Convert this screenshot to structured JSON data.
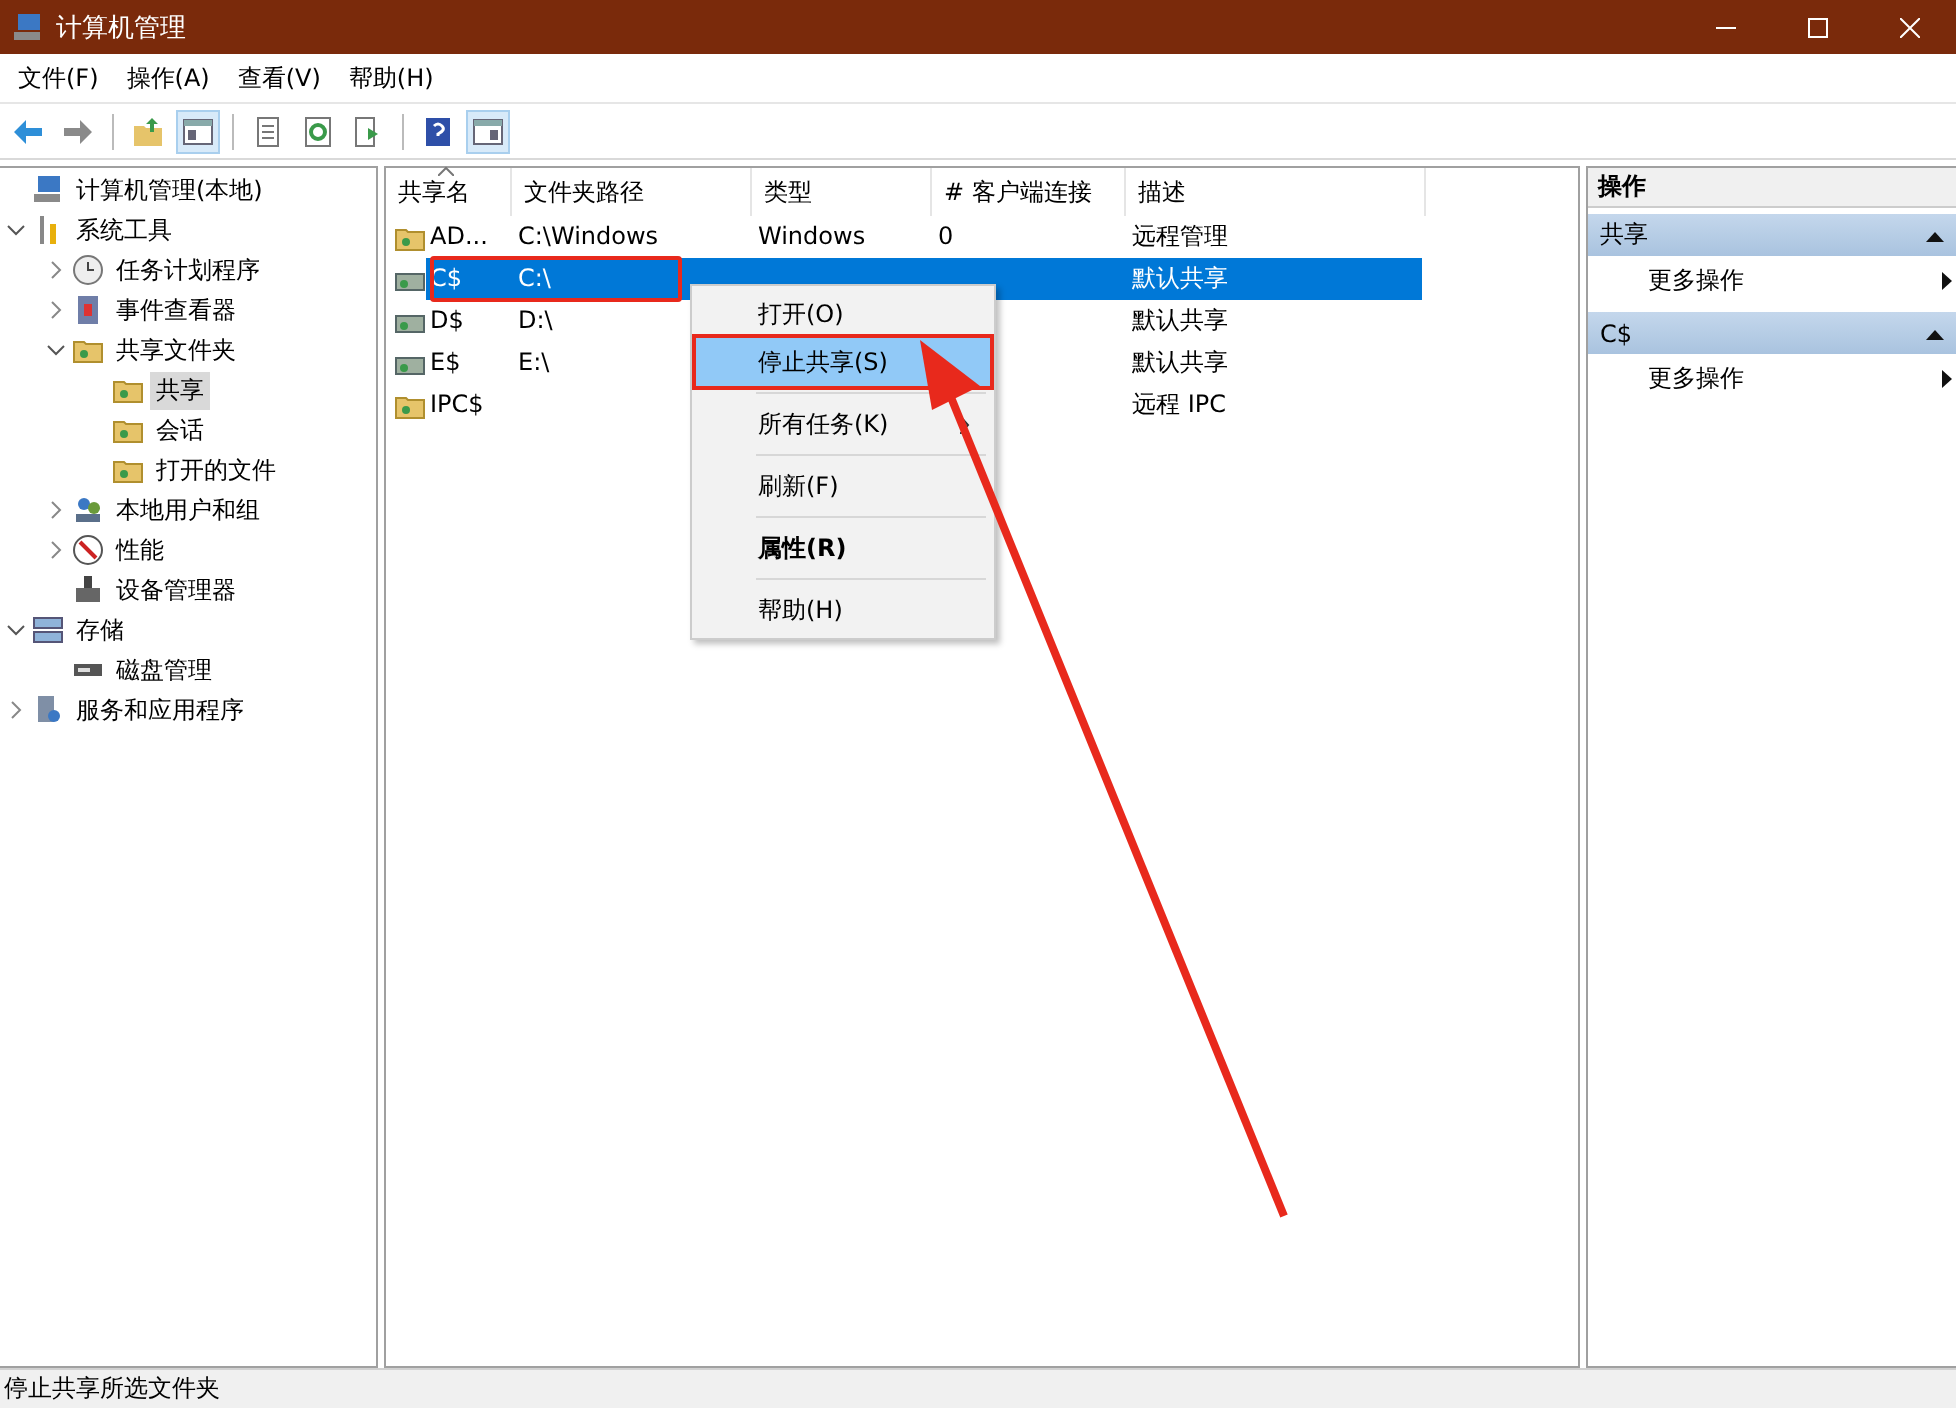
{
  "window": {
    "title": "计算机管理"
  },
  "menu": [
    "文件(F)",
    "操作(A)",
    "查看(V)",
    "帮助(H)"
  ],
  "toolbar": [
    {
      "kind": "back",
      "pressed": false
    },
    {
      "kind": "forward",
      "pressed": false
    },
    {
      "kind": "separator"
    },
    {
      "kind": "up",
      "pressed": false
    },
    {
      "kind": "tree-toggle",
      "pressed": true
    },
    {
      "kind": "separator"
    },
    {
      "kind": "properties",
      "pressed": false
    },
    {
      "kind": "refresh",
      "pressed": false
    },
    {
      "kind": "export",
      "pressed": false
    },
    {
      "kind": "separator"
    },
    {
      "kind": "help",
      "pressed": false
    },
    {
      "kind": "pane-toggle",
      "pressed": true
    }
  ],
  "tree": [
    {
      "label": "计算机管理(本地)",
      "kind": "computer",
      "selected": false,
      "children": [
        {
          "label": "系统工具",
          "kind": "tools",
          "expanded": true,
          "selected": false,
          "children": [
            {
              "label": "任务计划程序",
              "kind": "clock",
              "expanded": false,
              "selected": false
            },
            {
              "label": "事件查看器",
              "kind": "event",
              "expanded": false,
              "selected": false
            },
            {
              "label": "共享文件夹",
              "kind": "share",
              "expanded": true,
              "selected": false,
              "children": [
                {
                  "label": "共享",
                  "kind": "share",
                  "selected": true
                },
                {
                  "label": "会话",
                  "kind": "share",
                  "selected": false
                },
                {
                  "label": "打开的文件",
                  "kind": "share",
                  "selected": false
                }
              ]
            },
            {
              "label": "本地用户和组",
              "kind": "users",
              "expanded": false,
              "selected": false
            },
            {
              "label": "性能",
              "kind": "perf",
              "expanded": false,
              "selected": false
            },
            {
              "label": "设备管理器",
              "kind": "device",
              "selected": false
            }
          ]
        },
        {
          "label": "存储",
          "kind": "storage",
          "expanded": true,
          "selected": false,
          "children": [
            {
              "label": "磁盘管理",
              "kind": "disk",
              "selected": false
            }
          ]
        },
        {
          "label": "服务和应用程序",
          "kind": "services",
          "expanded": false,
          "selected": false
        }
      ]
    }
  ],
  "table": {
    "columns": [
      "共享名",
      "文件夹路径",
      "类型",
      "# 客户端连接",
      "描述"
    ],
    "rows": [
      {
        "kind": "folder",
        "name": "AD...",
        "path": "C:\\Windows",
        "type": "Windows",
        "clients": "0",
        "description": "远程管理",
        "selected": false,
        "marked": false
      },
      {
        "kind": "drive",
        "name": "C$",
        "path": "C:\\",
        "description": "默认共享",
        "selected": true,
        "marked": true
      },
      {
        "kind": "drive",
        "name": "D$",
        "path": "D:\\",
        "description": "默认共享",
        "selected": false,
        "marked": false
      },
      {
        "kind": "drive",
        "name": "E$",
        "path": "E:\\",
        "description": "默认共享",
        "selected": false,
        "marked": false
      },
      {
        "kind": "folder",
        "name": "IPC$",
        "description": "远程 IPC",
        "selected": false,
        "marked": false
      }
    ]
  },
  "context_menu": [
    {
      "kind": "item",
      "label": "打开(O)",
      "selected": false,
      "marked": false
    },
    {
      "kind": "item",
      "label": "停止共享(S)",
      "selected": true,
      "marked": true
    },
    {
      "kind": "separator"
    },
    {
      "kind": "item",
      "label": "所有任务(K)",
      "selected": false,
      "marked": false,
      "submenu": true
    },
    {
      "kind": "separator"
    },
    {
      "kind": "item",
      "label": "刷新(F)",
      "selected": false,
      "marked": false
    },
    {
      "kind": "separator"
    },
    {
      "kind": "item",
      "label": "属性(R)",
      "selected": false,
      "marked": false,
      "bold": true
    },
    {
      "kind": "separator"
    },
    {
      "kind": "item",
      "label": "帮助(H)",
      "selected": false,
      "marked": false
    }
  ],
  "actions": {
    "title": "操作",
    "sections": [
      {
        "title": "共享",
        "expanded": true,
        "items": [
          "更多操作"
        ]
      },
      {
        "title": "C$",
        "expanded": true,
        "items": [
          "更多操作"
        ]
      }
    ]
  },
  "status_bar": "停止共享所选文件夹"
}
